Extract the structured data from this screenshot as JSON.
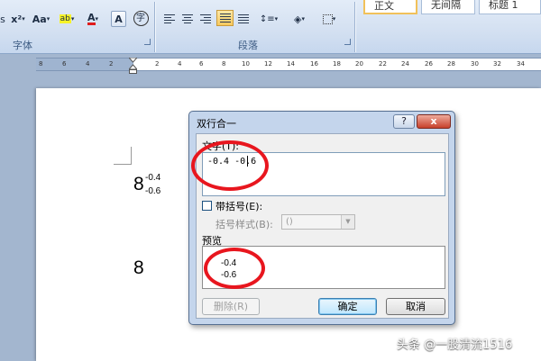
{
  "ribbon": {
    "font_group": {
      "label": "字体",
      "superscript_label": "x²",
      "change_case_label": "Aa",
      "highlight_label": "ab",
      "font_color_label": "A",
      "char_shading_label": "A",
      "enclose_char_label": "字"
    },
    "paragraph_group": {
      "label": "段落"
    },
    "styles": {
      "normal": "正文",
      "no_spacing": "无间隔",
      "heading1": "标题 1"
    }
  },
  "ruler": {
    "ticks": [
      "8",
      "6",
      "4",
      "2",
      "2",
      "4",
      "6",
      "8",
      "10",
      "12",
      "14",
      "16",
      "18",
      "20",
      "22",
      "24",
      "26",
      "28",
      "30",
      "32",
      "34"
    ]
  },
  "document": {
    "base_char_1": "8",
    "frac_top": "-0.4",
    "frac_bottom": "-0.6",
    "base_char_2": "8"
  },
  "dialog": {
    "title": "双行合一",
    "help_label": "?",
    "close_label": "x",
    "text_label": "文字(T):",
    "text_value": "-0.4 -0.6",
    "bracket_checkbox_label": "带括号(E):",
    "bracket_checked": false,
    "bracket_style_label": "括号样式(B):",
    "bracket_style_value": "()",
    "preview_label": "预览",
    "preview_top": "-0.4",
    "preview_bottom": "-0.6",
    "delete_label": "删除(R)",
    "ok_label": "确定",
    "cancel_label": "取消"
  },
  "annotation_color": "#e8161e",
  "watermark": "头条 @一股清流1516"
}
